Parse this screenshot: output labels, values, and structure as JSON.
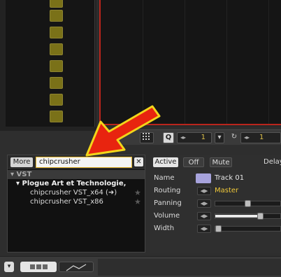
{
  "toolbar": {
    "quantize_label": "Q",
    "steps_value": "1",
    "swing_value": "1",
    "quantize_icon": "grid-icon",
    "loop_icon": "loop-icon"
  },
  "browser": {
    "more_label": "More",
    "search_value": "chipcrusher",
    "clear_icon": "close-icon",
    "category": "VST",
    "vendor": "Plogue Art et Technologie,",
    "items": [
      {
        "label": "chipcrusher VST_x64 (➜)"
      },
      {
        "label": "chipcrusher VST_x86"
      }
    ]
  },
  "inspector": {
    "active_label": "Active",
    "off_label": "Off",
    "mute_label": "Mute",
    "delay_label": "Delay",
    "rows": [
      {
        "label": "Name"
      },
      {
        "label": "Routing"
      },
      {
        "label": "Panning"
      },
      {
        "label": "Volume"
      },
      {
        "label": "Width"
      }
    ],
    "track_name": "Track 01",
    "routing_value": "Master",
    "track_color": "#a7a3dc",
    "panning_level": 0.5,
    "volume_level": 0.72,
    "width_level": 0.0
  },
  "colors": {
    "accent_red": "#b9251c",
    "pad_olive": "#7a7118",
    "routing_yellow": "#f0c93a",
    "search_border": "#e3b52a"
  },
  "bottom": {
    "view_icon_1": "list-view-icon",
    "view_icon_2": "automation-icon"
  }
}
